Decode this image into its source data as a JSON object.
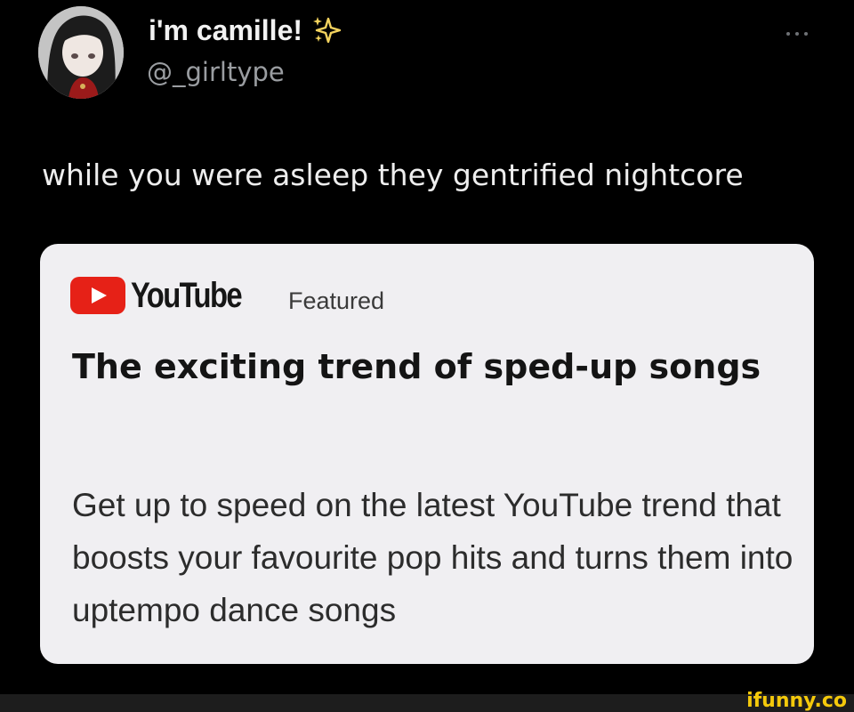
{
  "tweet": {
    "display_name": "i'm camille!",
    "name_emoji_icon": "sparkles-icon",
    "handle": "@_girltype",
    "more_icon": "ellipsis-icon",
    "text": "while you were asleep they gentrified nightcore"
  },
  "card": {
    "source_logo_icon": "youtube-play-icon",
    "source_name": "YouTube",
    "tag": "Featured",
    "title": "The exciting trend of sped-up songs",
    "description": "Get up to speed on the latest YouTube trend that boosts your favourite pop hits and turns them into uptempo dance songs"
  },
  "watermark": {
    "text": "ifunny.co"
  },
  "colors": {
    "background": "#000000",
    "card_background": "#f0eff2",
    "youtube_red": "#e62117",
    "watermark_yellow": "#f4c90b",
    "handle_gray": "#9a9da1"
  }
}
